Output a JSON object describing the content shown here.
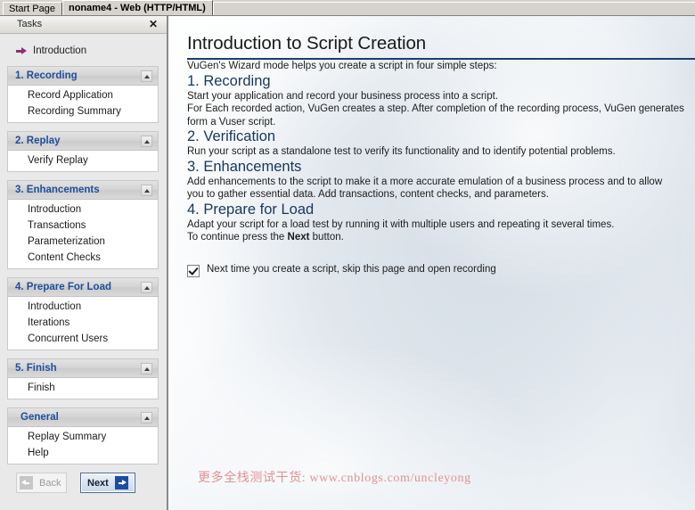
{
  "window": {
    "tabs": [
      {
        "label": "Start Page",
        "active": false
      },
      {
        "label": "noname4 - Web (HTTP/HTML)",
        "active": true
      }
    ]
  },
  "tasks_pane": {
    "title": "Tasks",
    "close_icon": "close-icon",
    "intro_link": {
      "label": "Introduction",
      "icon": "arrow-right-icon"
    },
    "groups": [
      {
        "title": "1. Recording",
        "chevron_icon": "chevron-up-icon",
        "items": [
          "Record Application",
          "Recording Summary"
        ]
      },
      {
        "title": "2. Replay",
        "chevron_icon": "chevron-up-icon",
        "items": [
          "Verify Replay"
        ]
      },
      {
        "title": "3. Enhancements",
        "chevron_icon": "chevron-up-icon",
        "items": [
          "Introduction",
          "Transactions",
          "Parameterization",
          "Content Checks"
        ]
      },
      {
        "title": "4. Prepare For Load",
        "chevron_icon": "chevron-up-icon",
        "items": [
          "Introduction",
          "Iterations",
          "Concurrent Users"
        ]
      },
      {
        "title": "5. Finish",
        "chevron_icon": "chevron-up-icon",
        "items": [
          "Finish"
        ]
      },
      {
        "title": "General",
        "chevron_icon": "chevron-up-icon",
        "items": [
          "Replay Summary",
          "Help"
        ]
      }
    ],
    "nav": {
      "back_label": "Back",
      "back_icon": "arrow-left-icon",
      "back_disabled": true,
      "next_label": "Next",
      "next_icon": "arrow-right-icon",
      "next_disabled": false
    }
  },
  "content": {
    "title": "Introduction to Script Creation",
    "lead": "VuGen's Wizard mode helps you create a script in four simple steps:",
    "steps": [
      {
        "heading": "1. Recording",
        "lines": [
          "Start your application and record your business process into a script.",
          "For Each recorded action, VuGen creates a step. After completion of the recording process, VuGen generates",
          "form a Vuser script."
        ]
      },
      {
        "heading": "2. Verification",
        "lines": [
          "Run your script as a standalone test to verify its functionality and to identify potential problems."
        ]
      },
      {
        "heading": "3. Enhancements",
        "lines": [
          "Add enhancements to the script to make it a more accurate emulation of a business process and to allow",
          "you to gather essential data. Add transactions, content checks, and parameters."
        ]
      },
      {
        "heading": "4. Prepare for Load",
        "lines": [
          "Adapt your script for a load test by running it with multiple users and repeating it several times."
        ]
      }
    ],
    "continue_prefix": "To continue press the ",
    "continue_bold": "Next",
    "continue_suffix": " button.",
    "skip_checkbox": {
      "checked": true,
      "label": "Next time you create a script, skip this page and open recording"
    }
  },
  "watermark": {
    "text": "更多全栈测试干货: www.cnblogs.com/uncleyong",
    "color": "#e08a8a"
  },
  "colors": {
    "group_title": "#1f4e9c",
    "step_heading": "#17365d",
    "title_rule": "#1b3f6e",
    "arrow_icon": "#8e2f72",
    "next_accent": "#1b4f9c"
  }
}
